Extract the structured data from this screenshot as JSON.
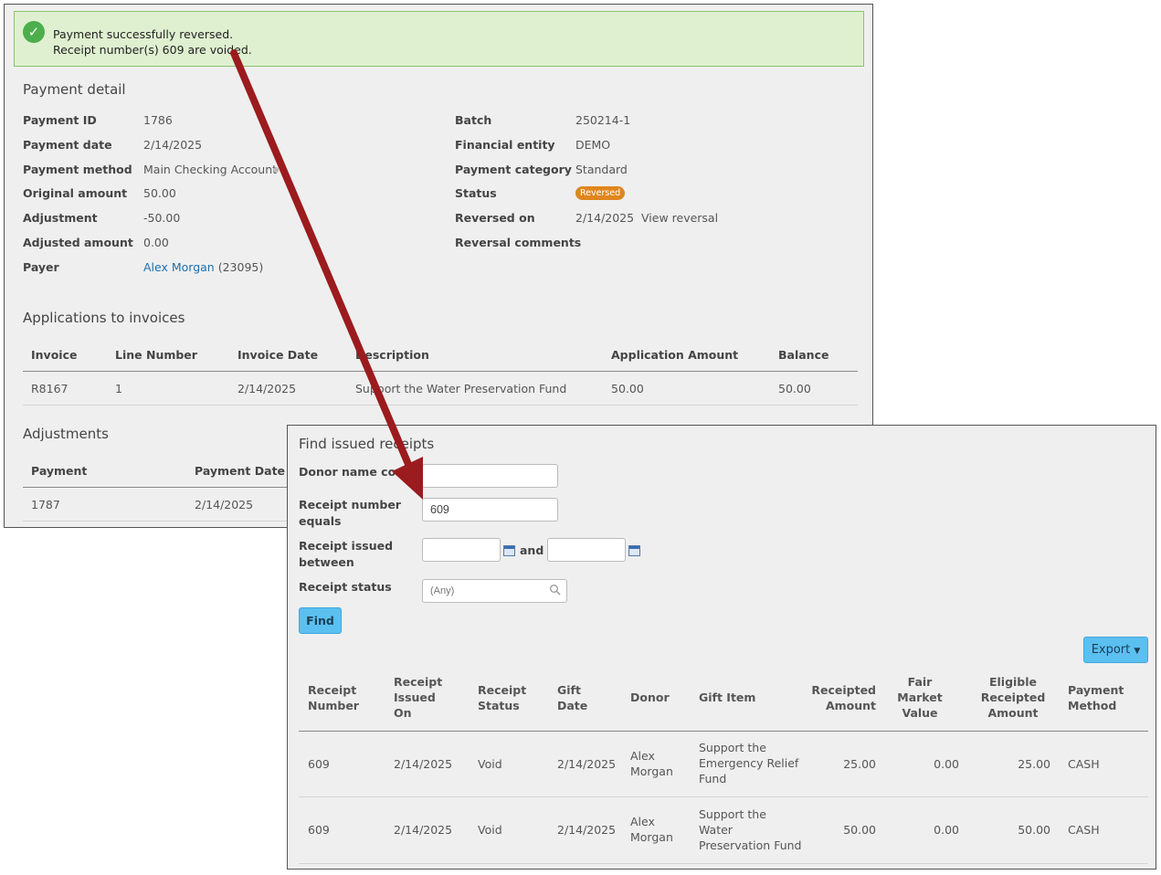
{
  "banner": {
    "line1": "Payment successfully reversed.",
    "line2": "Receipt number(s) 609 are voided."
  },
  "payment_detail": {
    "title": "Payment detail",
    "left": [
      {
        "label": "Payment ID",
        "value": "1786"
      },
      {
        "label": "Payment date",
        "value": "2/14/2025"
      },
      {
        "label": "Payment method",
        "value": "Main Checking Account"
      },
      {
        "label": "Original amount",
        "value": "50.00"
      },
      {
        "label": "Adjustment",
        "value": "-50.00"
      },
      {
        "label": "Adjusted amount",
        "value": "0.00"
      },
      {
        "label": "Payer",
        "value": "Alex Morgan",
        "extra": "(23095)"
      }
    ],
    "right": [
      {
        "label": "Batch",
        "value": "250214-1"
      },
      {
        "label": "Financial entity",
        "value": "DEMO"
      },
      {
        "label": "Payment category",
        "value": "Standard"
      },
      {
        "label": "Status",
        "value": "Reversed"
      },
      {
        "label": "Reversed on",
        "value": "2/14/2025",
        "link": "View reversal"
      },
      {
        "label": "Reversal comments",
        "value": ""
      }
    ]
  },
  "applications": {
    "title": "Applications to invoices",
    "headers": [
      "Invoice",
      "Line Number",
      "Invoice Date",
      "Description",
      "Application Amount",
      "Balance"
    ],
    "rows": [
      [
        "R8167",
        "1",
        "2/14/2025",
        "Support the Water Preservation Fund",
        "50.00",
        "50.00"
      ]
    ]
  },
  "adjustments": {
    "title": "Adjustments",
    "headers": [
      "Payment",
      "Payment Date"
    ],
    "rows": [
      [
        "1787",
        "2/14/2025"
      ]
    ]
  },
  "find": {
    "title": "Find issued receipts",
    "donor_label": "Donor name contains",
    "donor_value": "",
    "receipt_label_1": "Receipt number",
    "receipt_label_2": "equals",
    "receipt_value": "609",
    "issued_label_1": "Receipt issued",
    "issued_label_2": "between",
    "and_label": "and",
    "status_label": "Receipt status",
    "status_placeholder": "(Any)",
    "find_button": "Find",
    "export_button": "Export"
  },
  "receipts_table": {
    "headers": [
      [
        "Receipt",
        "Number"
      ],
      [
        "Receipt",
        "Issued",
        "On"
      ],
      [
        "Receipt",
        "Status"
      ],
      [
        "Gift",
        "Date"
      ],
      [
        "Donor"
      ],
      [
        "Gift Item"
      ],
      [
        "Receipted",
        "Amount"
      ],
      [
        "Fair",
        "Market",
        "Value"
      ],
      [
        "Eligible",
        "Receipted",
        "Amount"
      ],
      [
        "Payment",
        "Method"
      ]
    ],
    "rows": [
      {
        "number": "609",
        "issued": "2/14/2025",
        "status": "Void",
        "gift_date": "2/14/2025",
        "donor": [
          "Alex",
          "Morgan"
        ],
        "item": [
          "Support the",
          "Emergency Relief",
          "Fund"
        ],
        "receipted": "25.00",
        "fmv": "0.00",
        "eligible": "25.00",
        "method": "CASH"
      },
      {
        "number": "609",
        "issued": "2/14/2025",
        "status": "Void",
        "gift_date": "2/14/2025",
        "donor": [
          "Alex",
          "Morgan"
        ],
        "item": [
          "Support the",
          "Water",
          "Preservation Fund"
        ],
        "receipted": "50.00",
        "fmv": "0.00",
        "eligible": "50.00",
        "method": "CASH"
      }
    ]
  },
  "colors": {
    "arrow": "#9b1b1e",
    "success": "#4cae4c",
    "badge": "#e0861f",
    "button": "#5bc0f0",
    "link": "#1f6fa8"
  }
}
